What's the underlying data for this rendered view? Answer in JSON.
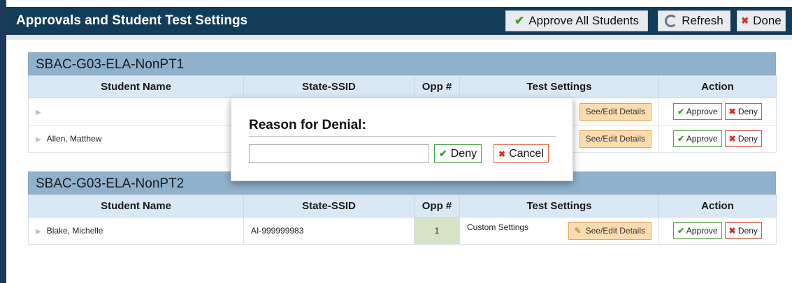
{
  "header": {
    "title": "Approvals and Student Test Settings",
    "approve_all": "Approve All Students",
    "refresh": "Refresh",
    "done": "Done"
  },
  "columns": {
    "student_name": "Student Name",
    "state_ssid": "State-SSID",
    "opp": "Opp #",
    "test_settings": "Test Settings",
    "action": "Action"
  },
  "sections": [
    {
      "title": "SBAC-G03-ELA-NonPT1",
      "rows": [
        {
          "name": "",
          "ssid": "",
          "opp": "",
          "settings": "",
          "see": "See/Edit Details",
          "approve": "Approve",
          "deny": "Deny"
        },
        {
          "name": "Allen, Matthew",
          "ssid": "",
          "opp": "",
          "settings": "",
          "see": "See/Edit Details",
          "approve": "Approve",
          "deny": "Deny"
        }
      ]
    },
    {
      "title": "SBAC-G03-ELA-NonPT2",
      "rows": [
        {
          "name": "Blake, Michelle",
          "ssid": "AI-999999983",
          "opp": "1",
          "settings": "Custom Settings",
          "see": "See/Edit Details",
          "approve": "Approve",
          "deny": "Deny"
        }
      ]
    }
  ],
  "modal": {
    "title": "Reason for Denial:",
    "input_value": "",
    "deny": "Deny",
    "cancel": "Cancel"
  },
  "colors": {
    "header_bg": "#133c58",
    "section_bg": "#8fb1cc",
    "column_header_bg": "#d9e8f4",
    "opp_bg": "#d6e3c6",
    "see_btn_bg": "#fbdcb0"
  }
}
